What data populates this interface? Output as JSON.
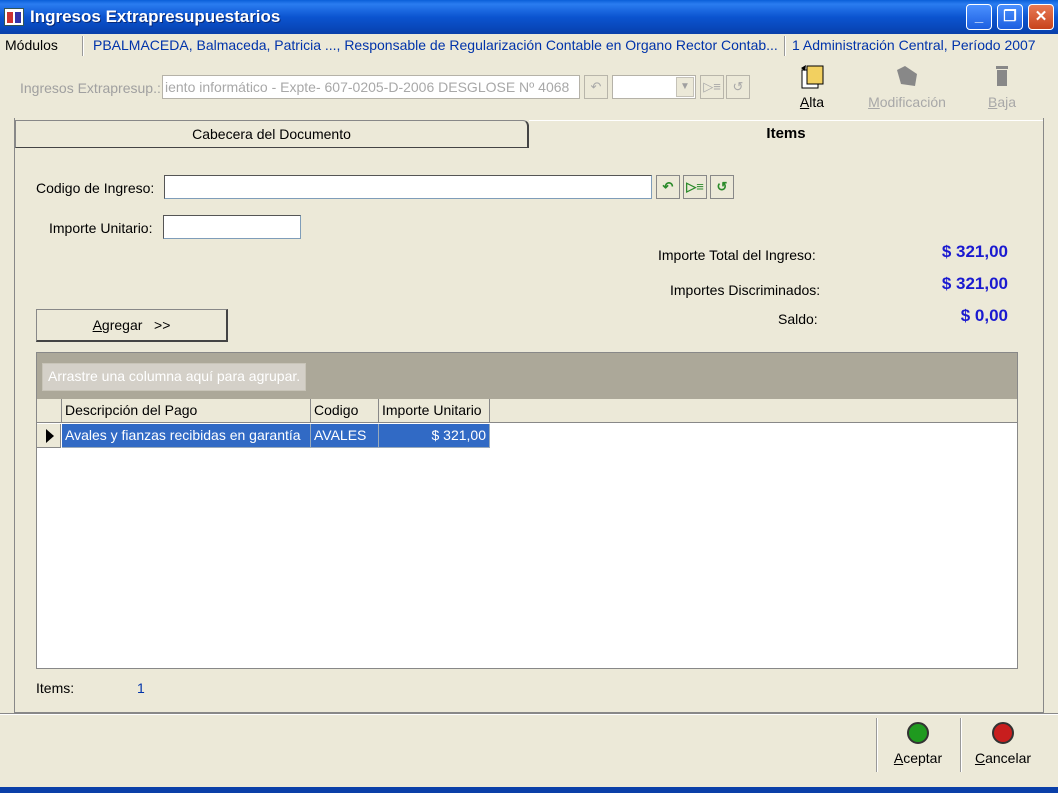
{
  "window": {
    "title": "Ingresos Extrapresupuestarios",
    "minimize_glyph": "_",
    "maximize_glyph": "❐",
    "close_glyph": "✕"
  },
  "infobar": {
    "modulos": "Módulos",
    "user": "PBALMACEDA, Balmaceda, Patricia ..., Responsable de Regularización Contable en Organo Rector Contab...",
    "period": "1 Administración Central, Período 2007"
  },
  "toolbar": {
    "label": "Ingresos Extrapresup.:",
    "document_value": "iento informático - Expte- 607-0205-D-2006 DESGLOSE Nº 4068",
    "combo_value": "",
    "actions": {
      "alta_prefix": "A",
      "alta_rest": "lta",
      "modificacion_prefix": "M",
      "modificacion_rest": "odificación",
      "baja_prefix": "B",
      "baja_rest": "aja"
    }
  },
  "tabs": {
    "cabecera": "Cabecera del Documento",
    "items": "Items"
  },
  "form": {
    "codigo_label": "Codigo de Ingreso:",
    "codigo_value": "",
    "importe_label": "Importe Unitario:",
    "importe_value": "",
    "total_label": "Importe Total del Ingreso:",
    "total_value": "$ 321,00",
    "discriminados_label": "Importes Discriminados:",
    "discriminados_value": "$ 321,00",
    "saldo_label": "Saldo:",
    "saldo_value": "$ 0,00",
    "agregar_prefix": "A",
    "agregar_rest": "gregar   >>"
  },
  "grid": {
    "group_hint": "Arrastre una columna aquí para agrupar.",
    "columns": [
      "Descripción del Pago",
      "Codigo",
      "Importe Unitario"
    ],
    "rows": [
      [
        "Avales y fianzas recibidas en garantía",
        "AVALES",
        "$ 321,00"
      ]
    ]
  },
  "footer": {
    "items_label": "Items:",
    "items_count": "1",
    "aceptar_prefix": "A",
    "aceptar_rest": "ceptar",
    "cancelar_prefix": "C",
    "cancelar_rest": "ancelar"
  },
  "colors": {
    "accept": "#1f9a1f",
    "cancel": "#c81e1e",
    "amount": "#1a1ad0"
  }
}
